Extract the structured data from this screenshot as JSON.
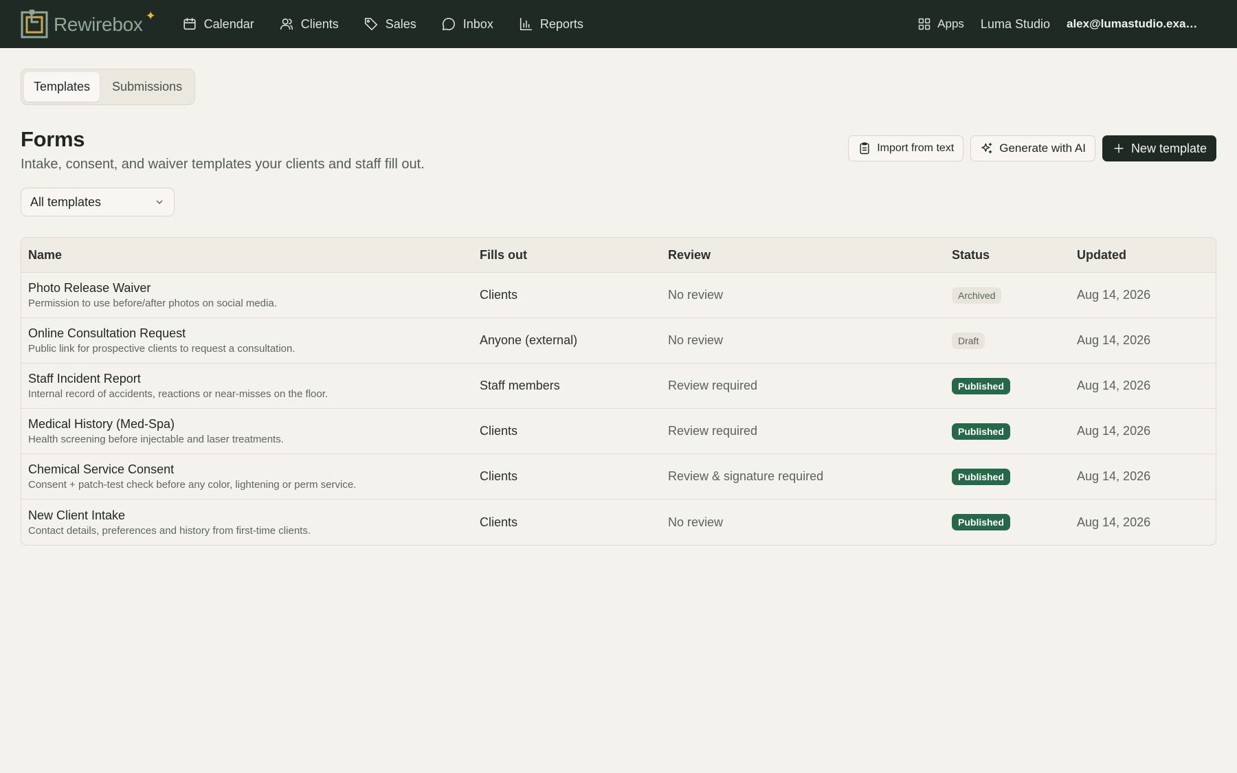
{
  "app": {
    "brand": "Rewirebox",
    "nav": [
      {
        "label": "Calendar",
        "icon": "calendar-icon"
      },
      {
        "label": "Clients",
        "icon": "users-icon"
      },
      {
        "label": "Sales",
        "icon": "tag-icon"
      },
      {
        "label": "Inbox",
        "icon": "chat-icon"
      },
      {
        "label": "Reports",
        "icon": "bar-chart-icon"
      }
    ],
    "apps_label": "Apps",
    "studio": "Luma Studio",
    "account": "alex@lumastudio.example.com"
  },
  "tabs": [
    {
      "label": "Templates",
      "active": true
    },
    {
      "label": "Submissions",
      "active": false
    }
  ],
  "page": {
    "title": "Forms",
    "subtitle": "Intake, consent, and waiver templates your clients and staff fill out.",
    "actions": {
      "import": "Import from text",
      "generate": "Generate with AI",
      "new": "New template"
    },
    "filter": "All templates"
  },
  "table": {
    "columns": [
      "Name",
      "Fills out",
      "Review",
      "Status",
      "Updated"
    ],
    "rows": [
      {
        "name": "Photo Release Waiver",
        "desc": "Permission to use before/after photos on social media.",
        "fills": "Clients",
        "review": "No review",
        "status": "Archived",
        "updated": "Aug 14, 2026"
      },
      {
        "name": "Online Consultation Request",
        "desc": "Public link for prospective clients to request a consultation.",
        "fills": "Anyone (external)",
        "review": "No review",
        "status": "Draft",
        "updated": "Aug 14, 2026"
      },
      {
        "name": "Staff Incident Report",
        "desc": "Internal record of accidents, reactions or near-misses on the floor.",
        "fills": "Staff members",
        "review": "Review required",
        "status": "Published",
        "updated": "Aug 14, 2026"
      },
      {
        "name": "Medical History (Med-Spa)",
        "desc": "Health screening before injectable and laser treatments.",
        "fills": "Clients",
        "review": "Review required",
        "status": "Published",
        "updated": "Aug 14, 2026"
      },
      {
        "name": "Chemical Service Consent",
        "desc": "Consent + patch-test check before any color, lightening or perm service.",
        "fills": "Clients",
        "review": "Review & signature required",
        "status": "Published",
        "updated": "Aug 14, 2026"
      },
      {
        "name": "New Client Intake",
        "desc": "Contact details, preferences and history from first-time clients.",
        "fills": "Clients",
        "review": "No review",
        "status": "Published",
        "updated": "Aug 14, 2026"
      }
    ]
  },
  "colors": {
    "topbar": "#1f2a24",
    "background": "#f4f2ec",
    "published": "#25694a",
    "brand_accent": "#f2b53a"
  }
}
